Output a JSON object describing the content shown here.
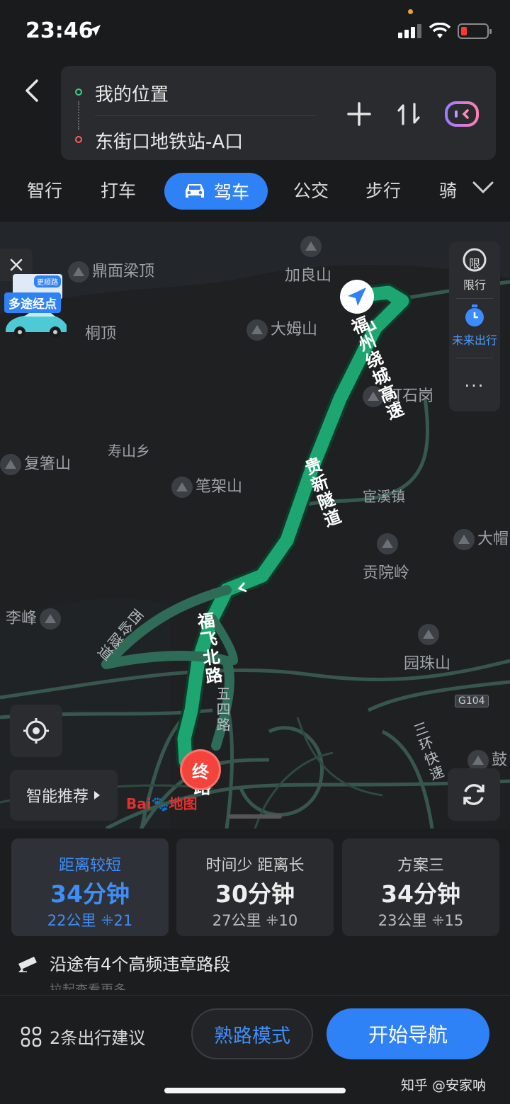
{
  "status_bar": {
    "time": "23:46"
  },
  "route": {
    "origin": "我的位置",
    "destination": "东街口地铁站-A口"
  },
  "modes": [
    {
      "label": "智行"
    },
    {
      "label": "打车"
    },
    {
      "label": "驾车",
      "active": true
    },
    {
      "label": "公交"
    },
    {
      "label": "步行"
    },
    {
      "label": "骑"
    }
  ],
  "map": {
    "side_panel": {
      "limit_icon_text": "限",
      "limit_label": "限行",
      "future_label": "未来出行",
      "more_label": "···"
    },
    "multi_stop": {
      "label": "多途经点",
      "mini_tag": "更顺路"
    },
    "smart_recommend": "智能推荐",
    "baidu_logo_a": "Bai",
    "baidu_logo_b": "地图",
    "end_marker": "终",
    "highway_shield": "G104",
    "places": [
      "鼎面梁顶",
      "加良山",
      "桐顶",
      "大姆山",
      "打石岗",
      "寿山乡",
      "复箸山",
      "笔架山",
      "宦溪镇",
      "大帽",
      "贡院岭",
      "李峰",
      "园珠山",
      "鼓"
    ],
    "roads": {
      "fuzhou_ring": "福州绕城高速",
      "guixin_tunnel": "贵新隧道",
      "xiling_tunnel": "西岭隧道",
      "fufei_north": "福飞北路",
      "wusi_road": "五四路",
      "sanhuan": "三环快速",
      "fulu_partial": "路"
    }
  },
  "plans": [
    {
      "title": "距离较短",
      "time": "34分钟",
      "distance": "22公里",
      "lights": "21",
      "selected": true
    },
    {
      "title": "时间少 距离长",
      "time": "30分钟",
      "distance": "27公里",
      "lights": "10",
      "selected": false
    },
    {
      "title": "方案三",
      "time": "34分钟",
      "distance": "23公里",
      "lights": "15",
      "selected": false
    }
  ],
  "warning": {
    "text": "沿途有4个高频违章路段",
    "sub": "拉起查看更多"
  },
  "bottom": {
    "advice": "2条出行建议",
    "familiar": "熟路模式",
    "start": "开始导航",
    "watermark": "知乎 @安家呐"
  },
  "colors": {
    "accent": "#2f82f5",
    "route_green": "#1ea672",
    "end_red": "#f4433a"
  }
}
